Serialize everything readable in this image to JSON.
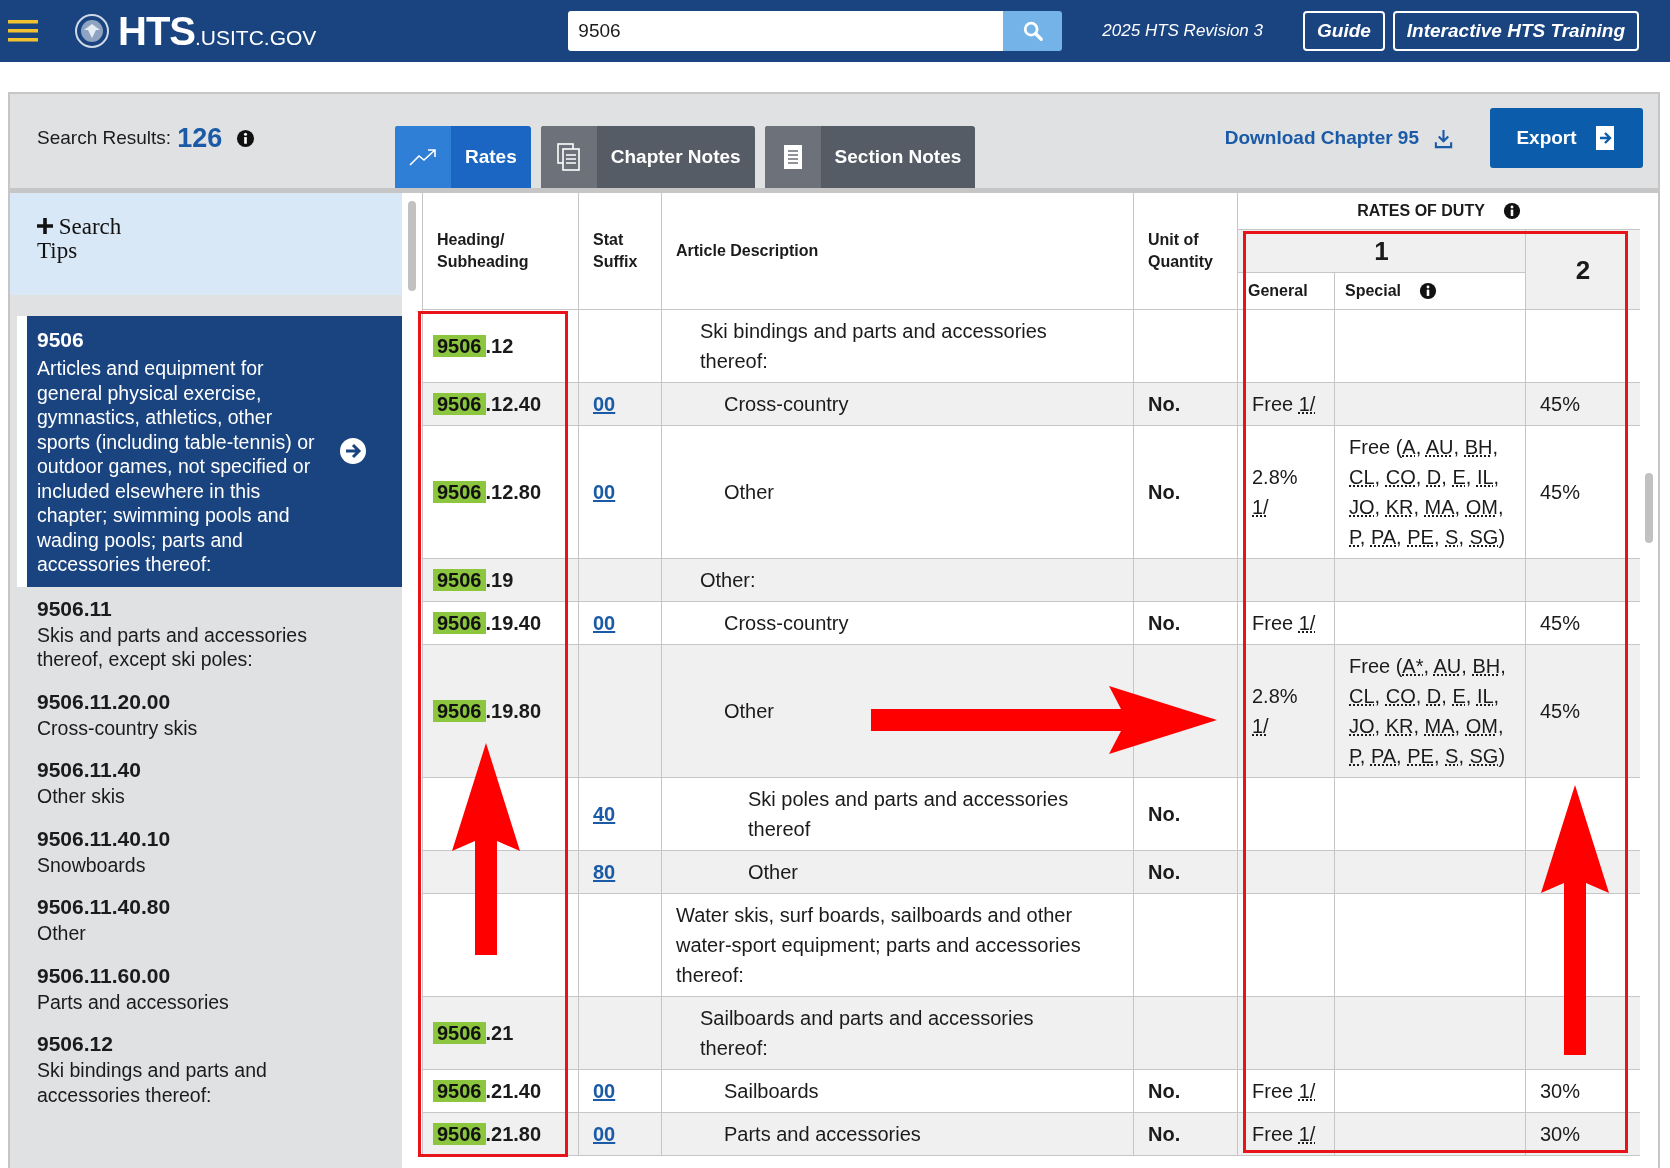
{
  "header": {
    "logo_main": "HTS",
    "logo_domain": ".USITC.GOV",
    "search_value": "9506",
    "revision": "2025 HTS Revision 3",
    "buttons": [
      "Guide",
      "Interactive HTS Training"
    ]
  },
  "toolbar": {
    "results_label": "Search Results:",
    "results_count": "126",
    "tabs": [
      {
        "label": "Rates",
        "kind": "chart",
        "selected": true
      },
      {
        "label": "Chapter Notes",
        "kind": "pages",
        "selected": false
      },
      {
        "label": "Section Notes",
        "kind": "page",
        "selected": false
      }
    ],
    "download": "Download Chapter 95",
    "export": "Export"
  },
  "sidebar": {
    "search_tips": "Search Tips",
    "items": [
      {
        "code": "9506",
        "text": "Articles and equipment for general physical exercise, gymnastics, athletics, other sports (including table-tennis) or outdoor games, not specified or included elsewhere in this chapter; swimming pools and wading pools; parts and accessories thereof:",
        "selected": true
      },
      {
        "code": "9506.11",
        "text": "Skis and parts and accessories thereof, except ski poles:",
        "selected": false
      },
      {
        "code": "9506.11.20.00",
        "text": "Cross-country skis",
        "selected": false
      },
      {
        "code": "9506.11.40",
        "text": "Other skis",
        "selected": false
      },
      {
        "code": "9506.11.40.10",
        "text": "Snowboards",
        "selected": false
      },
      {
        "code": "9506.11.40.80",
        "text": "Other",
        "selected": false
      },
      {
        "code": "9506.11.60.00",
        "text": "Parts and accessories",
        "selected": false
      },
      {
        "code": "9506.12",
        "text": "Ski bindings and parts and accessories thereof:",
        "selected": false
      }
    ]
  },
  "table": {
    "columns": {
      "heading": "Heading/ Subheading",
      "stat": "Stat Suffix",
      "description": "Article Description",
      "unit": "Unit of Quantity",
      "rates": "RATES OF DUTY",
      "column_1": "1",
      "general": "General",
      "special": "Special",
      "column_2": "2"
    },
    "rows": [
      {
        "kind": "continuation",
        "children": [
          {
            "kind": "row",
            "heading_match": "9506",
            "heading_rest": ".12",
            "description": "Ski bindings and parts and accessories thereof:",
            "children": [
              {
                "kind": "row",
                "heading_match": "9506",
                "heading_rest": ".12.40",
                "stat": "00",
                "description": "Cross-country",
                "unit": "No.",
                "general": {
                  "text": "Free",
                  "footnote": "1/"
                },
                "column_2": "45%"
              },
              {
                "kind": "row",
                "heading_match": "9506",
                "heading_rest": ".12.80",
                "stat": "00",
                "description": "Other",
                "unit": "No.",
                "general": {
                  "text": "2.8%",
                  "footnote": "1/"
                },
                "special": {
                  "open": "Free (",
                  "codes": [
                    "A",
                    "AU",
                    "BH",
                    "CL",
                    "CO",
                    "D",
                    "E",
                    "IL",
                    "JO",
                    "KR",
                    "MA",
                    "OM",
                    "P",
                    "PA",
                    "PE",
                    "S",
                    "SG"
                  ],
                  "separator": ", ",
                  "close": ")"
                },
                "column_2": "45%"
              }
            ]
          },
          {
            "kind": "row",
            "heading_match": "9506",
            "heading_rest": ".19",
            "description": "Other:",
            "children": [
              {
                "kind": "row",
                "heading_match": "9506",
                "heading_rest": ".19.40",
                "stat": "00",
                "description": "Cross-country",
                "unit": "No.",
                "general": {
                  "text": "Free",
                  "footnote": "1/"
                },
                "column_2": "45%"
              },
              {
                "kind": "row",
                "heading_match": "9506",
                "heading_rest": ".19.80",
                "description": "Other",
                "general": {
                  "text": "2.8%",
                  "footnote": "1/"
                },
                "special": {
                  "open": "Free (",
                  "codes": [
                    "A*",
                    "AU",
                    "BH",
                    "CL",
                    "CO",
                    "D",
                    "E",
                    "IL",
                    "JO",
                    "KR",
                    "MA",
                    "OM",
                    "P",
                    "PA",
                    "PE",
                    "S",
                    "SG"
                  ],
                  "separator": ", ",
                  "close": ")"
                },
                "column_2": "45%",
                "children": [
                  {
                    "kind": "row",
                    "stat": "40",
                    "description": "Ski poles and parts and accessories thereof",
                    "unit": "No."
                  },
                  {
                    "kind": "row",
                    "stat": "80",
                    "description": "Other",
                    "unit": "No."
                  }
                ]
              }
            ]
          }
        ]
      },
      {
        "kind": "row",
        "description": "Water skis, surf boards, sailboards and other water-sport equipment; parts and accessories thereof:",
        "children": [
          {
            "kind": "row",
            "heading_match": "9506",
            "heading_rest": ".21",
            "description": "Sailboards and parts and accessories thereof:",
            "children": [
              {
                "kind": "row",
                "heading_match": "9506",
                "heading_rest": ".21.40",
                "stat": "00",
                "description": "Sailboards",
                "unit": "No.",
                "general": {
                  "text": "Free",
                  "footnote": "1/"
                },
                "column_2": "30%"
              },
              {
                "kind": "row",
                "heading_match": "9506",
                "heading_rest": ".21.80",
                "stat": "00",
                "description": "Parts and accessories",
                "unit": "No.",
                "general": {
                  "text": "Free",
                  "footnote": "1/"
                },
                "column_2": "30%"
              }
            ]
          }
        ]
      }
    ]
  }
}
